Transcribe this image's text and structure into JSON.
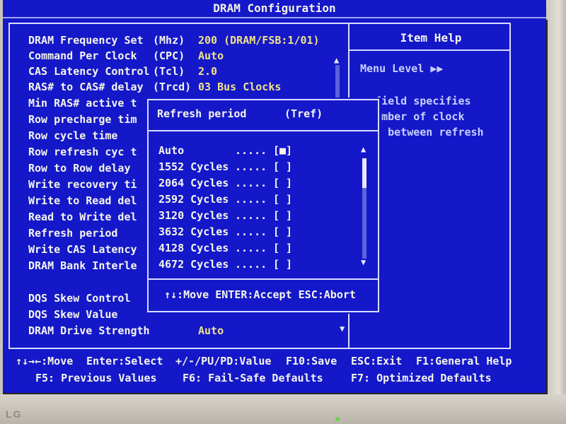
{
  "title": "DRAM Configuration",
  "settings": [
    {
      "label": "DRAM Frequency Set",
      "abbr": "(Mhz)",
      "value": "200 (DRAM/FSB:1/01)"
    },
    {
      "label": "Command Per Clock",
      "abbr": "(CPC)",
      "value": "Auto"
    },
    {
      "label": "CAS Latency Control",
      "abbr": "(Tcl)",
      "value": "2.0"
    },
    {
      "label": "RAS# to CAS# delay",
      "abbr": "(Trcd)",
      "value": "03 Bus Clocks"
    },
    {
      "label": "Min RAS# active t",
      "abbr": "",
      "value": ""
    },
    {
      "label": "Row precharge tim",
      "abbr": "",
      "value": ""
    },
    {
      "label": "Row cycle time",
      "abbr": "",
      "value": ""
    },
    {
      "label": "Row refresh cyc t",
      "abbr": "",
      "value": ""
    },
    {
      "label": "Row to Row delay",
      "abbr": "",
      "value": ""
    },
    {
      "label": "Write recovery ti",
      "abbr": "",
      "value": ""
    },
    {
      "label": "Write to Read del",
      "abbr": "",
      "value": ""
    },
    {
      "label": "Read to Write del",
      "abbr": "",
      "value": ""
    },
    {
      "label": "Refresh period",
      "abbr": "",
      "value": ""
    },
    {
      "label": "Write CAS Latency",
      "abbr": "",
      "value": ""
    },
    {
      "label": "DRAM Bank Interle",
      "abbr": "",
      "value": ""
    },
    {
      "label": "",
      "abbr": "",
      "value": ""
    },
    {
      "label": "DQS Skew Control",
      "abbr": "",
      "value": ""
    },
    {
      "label": "DQS Skew Value",
      "abbr": "",
      "value": ""
    },
    {
      "label": "DRAM Drive Strength",
      "abbr": "",
      "value": "Auto"
    }
  ],
  "help": {
    "title": "Item Help",
    "menu_level": "Menu Level   ▶▶",
    "text": "s field specifies\n number of clock\nles between refresh"
  },
  "popup": {
    "title": "Refresh period",
    "title_abbr": "(Tref)",
    "options": [
      {
        "name": "Auto",
        "dots": ".....",
        "box": "[■]"
      },
      {
        "name": "1552 Cycles",
        "dots": ".....",
        "box": "[ ]"
      },
      {
        "name": "2064 Cycles",
        "dots": ".....",
        "box": "[ ]"
      },
      {
        "name": "2592 Cycles",
        "dots": ".....",
        "box": "[ ]"
      },
      {
        "name": "3120 Cycles",
        "dots": ".....",
        "box": "[ ]"
      },
      {
        "name": "3632 Cycles",
        "dots": ".....",
        "box": "[ ]"
      },
      {
        "name": "4128 Cycles",
        "dots": ".....",
        "box": "[ ]"
      },
      {
        "name": "4672 Cycles",
        "dots": ".....",
        "box": "[ ]"
      }
    ],
    "footer": "↑↓:Move ENTER:Accept ESC:Abort"
  },
  "keys": {
    "move": "↑↓→←:Move",
    "enter": "Enter:Select",
    "change": "+/-/PU/PD:Value",
    "save": "F10:Save",
    "exit": "ESC:Exit",
    "help": "F1:General Help",
    "prev": "F5: Previous Values",
    "failsafe": "F6: Fail-Safe Defaults",
    "optimized": "F7: Optimized Defaults"
  },
  "monitor": {
    "brand": "LG"
  },
  "colors": {
    "background": "#1418c8",
    "text": "#f5f5ee",
    "value": "#f0e28a",
    "help": "#c9d0ff"
  }
}
